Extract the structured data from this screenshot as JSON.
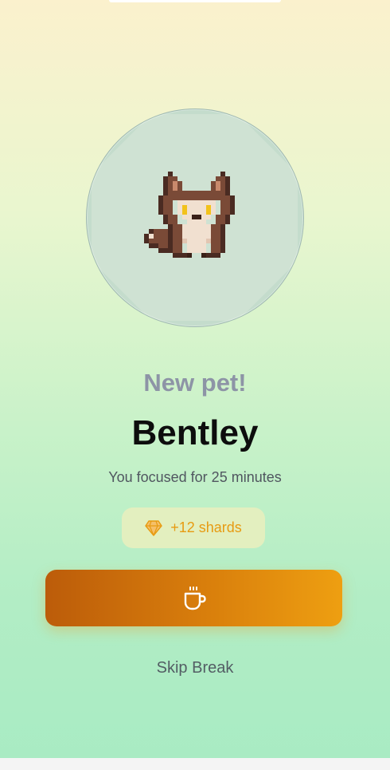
{
  "reward": {
    "headline": "New pet!",
    "pet_name": "Bentley",
    "focus_summary": "You focused for 25 minutes",
    "shards_label": "+12 shards"
  },
  "actions": {
    "break_icon": "coffee-cup-icon",
    "skip_label": "Skip Break"
  },
  "icons": {
    "pet": "fox-pixel-sprite",
    "shards": "diamond-icon"
  },
  "colors": {
    "shards_accent": "#e79b12",
    "button_start": "#bc5c0a",
    "button_end": "#ee9f11",
    "headline": "#8d94a6"
  }
}
